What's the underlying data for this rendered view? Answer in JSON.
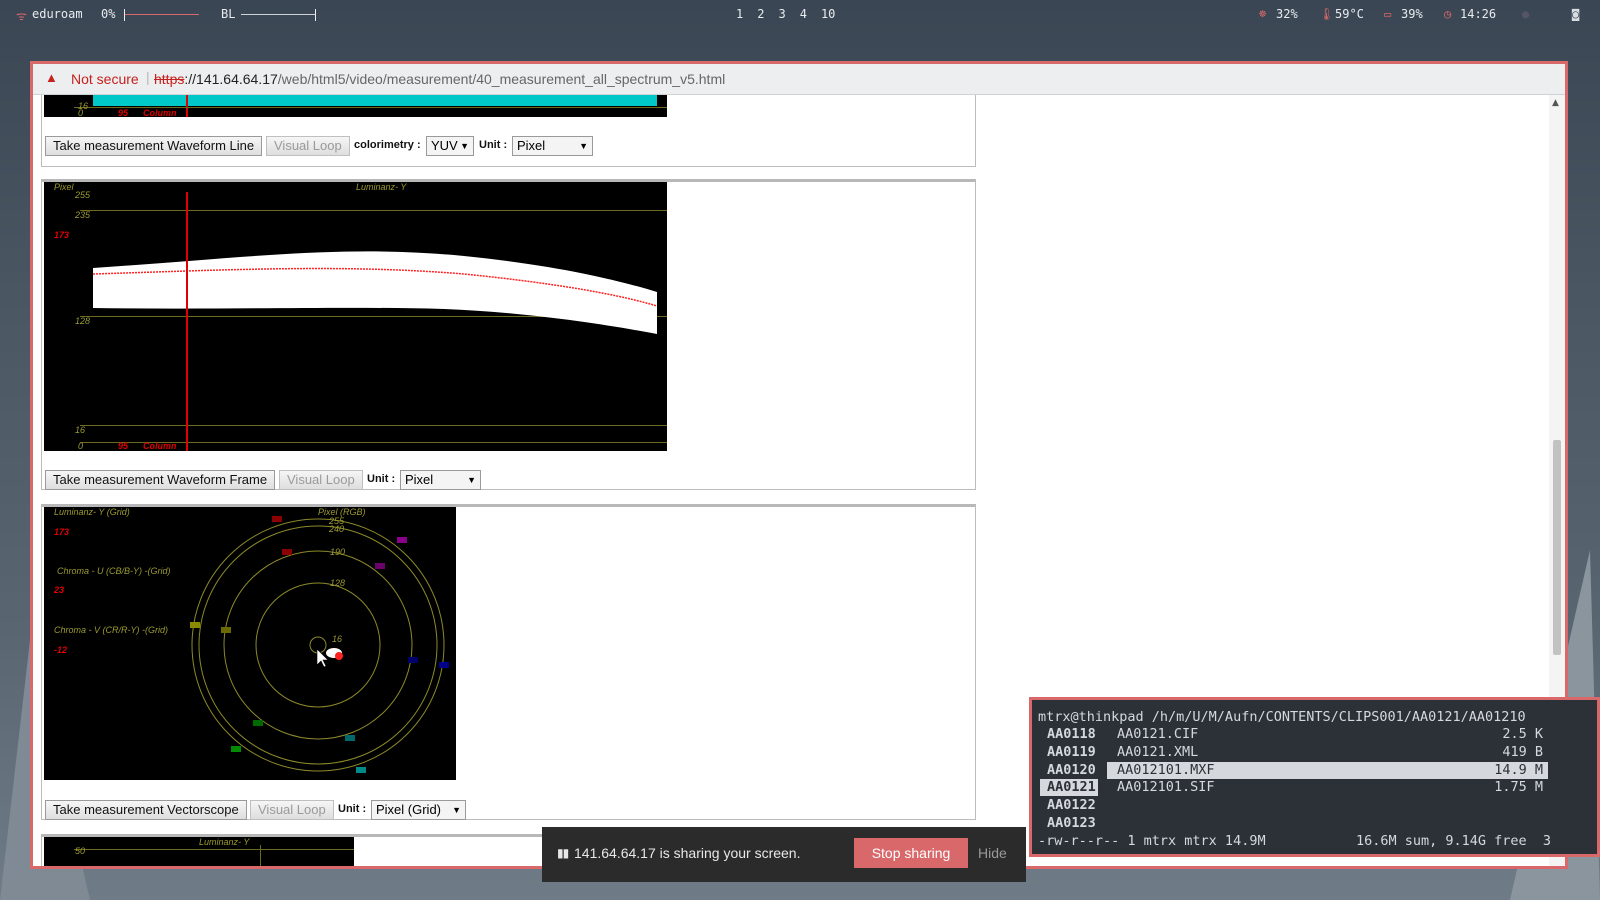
{
  "topbar": {
    "wifi": "eduroam",
    "volume": "0%",
    "backlight": "BL",
    "workspaces": [
      "1",
      "2",
      "3",
      "4",
      "10"
    ],
    "cpu": "32%",
    "temp": "59°C",
    "battery": "39%",
    "time": "14:26"
  },
  "browser": {
    "security_text": "Not secure",
    "url_scheme": "https",
    "url_host": "://141.64.64.17",
    "url_path": "/web/html5/video/measurement/40_measurement_all_spectrum_v5.html"
  },
  "panel1": {
    "scope_labels": {
      "y16": "16",
      "y0": "0",
      "col_value": "95",
      "col_label": "Column"
    },
    "take_button": "Take measurement Waveform Line",
    "loop_button": "Visual Loop",
    "colorimetry_label": "colorimetry :",
    "colorimetry_value": "YUV",
    "unit_label": "Unit :",
    "unit_value": "Pixel"
  },
  "panel2": {
    "scope_labels": {
      "pixel": "Pixel",
      "title": "Luminanz- Y",
      "y255": "255",
      "y235": "235",
      "value": "173",
      "y128": "128",
      "y16": "16",
      "y0": "0",
      "col_value": "95",
      "col_label": "Column"
    },
    "take_button": "Take measurement Waveform Frame",
    "loop_button": "Visual Loop",
    "unit_label": "Unit :",
    "unit_value": "Pixel"
  },
  "panel3": {
    "scope_labels": {
      "lum_title": "Luminanz- Y (Grid)",
      "lum_value": "173",
      "u_title": "Chroma - U (CB/B-Y) -(Grid)",
      "u_value": "23",
      "v_title": "Chroma - V (CR/R-Y) -(Grid)",
      "v_value": "-12",
      "pixel_rgb": "Pixel (RGB)",
      "r255": "255",
      "r240": "240",
      "r190": "190",
      "r128": "128",
      "r16": "16"
    },
    "take_button": "Take measurement Vectorscope",
    "loop_button": "Visual Loop",
    "unit_label": "Unit :",
    "unit_value": "Pixel (Grid)"
  },
  "panel4": {
    "scope_title": "Luminanz- Y",
    "y50": "50"
  },
  "terminal": {
    "prompt": "mtrx@thinkpad /h/m/U/M/Aufn/CONTENTS/CLIPS001/AA0121/AA01210",
    "dirs": [
      "AA0118",
      "AA0119",
      "AA0120",
      "AA0121",
      "AA0122",
      "AA0123"
    ],
    "files": [
      {
        "name": "AA0121.CIF",
        "size": "2.5 K"
      },
      {
        "name": "AA0121.XML",
        "size": "419 B"
      },
      {
        "name": "AA012101.MXF",
        "size": "14.9 M"
      },
      {
        "name": "AA012101.SIF",
        "size": "1.75 M"
      }
    ],
    "status_left": "-rw-r--r-- 1 mtrx mtrx 14.9M",
    "status_right": "16.6M sum, 9.14G free  3"
  },
  "share": {
    "message": "141.64.64.17 is sharing your screen.",
    "stop_button": "Stop sharing",
    "hide_button": "Hide"
  },
  "colors": {
    "accent": "#d9686b",
    "scope_cyan": "#00c8c8",
    "grid_olive": "#9c9a30",
    "cursor_red": "#e00000"
  }
}
